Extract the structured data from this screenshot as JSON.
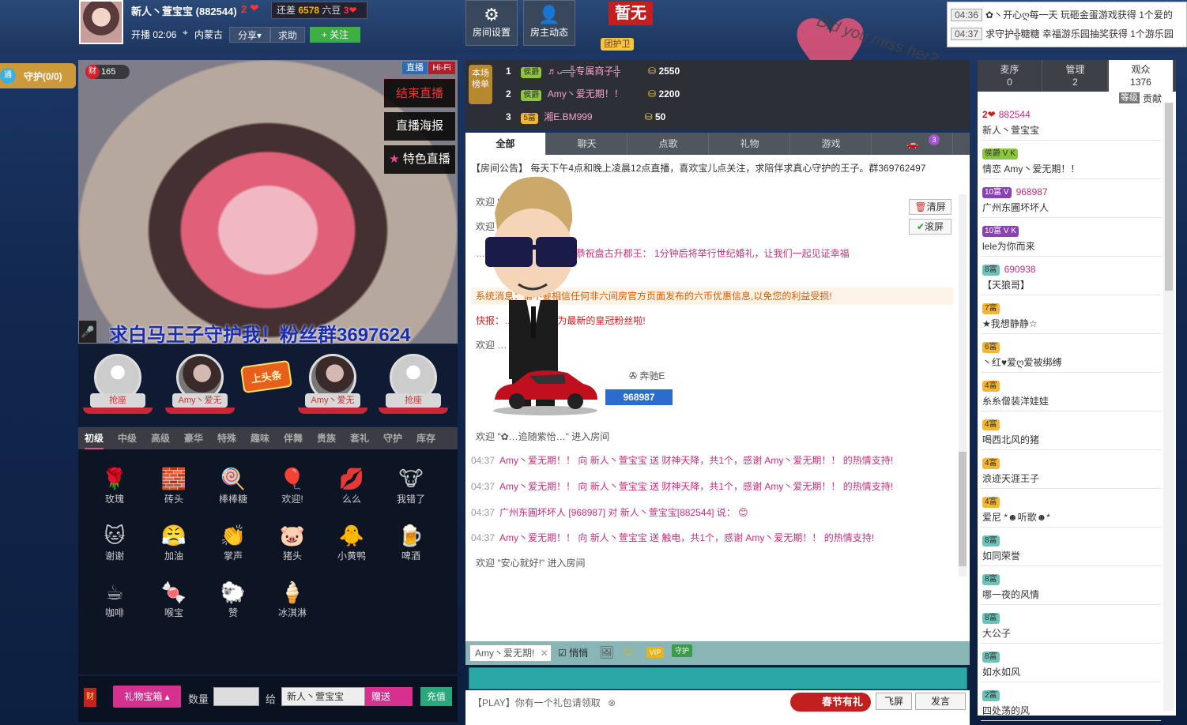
{
  "header": {
    "host_name": "新人丶萱宝宝",
    "host_id": "(882544)",
    "host_rank": "2",
    "gap_text_prefix": "还差",
    "gap_amount": "6578",
    "gap_text_suffix": "六豆",
    "gap_rank": "3",
    "live_time": "开播 02:06",
    "location": "内蒙古",
    "share_label": "分享▾",
    "help_label": "求助",
    "follow_label": "+ 关注",
    "room_settings_label": "房间设置",
    "host_dynamic_label": "房主动态",
    "no_label": "暂无",
    "guard_team_label": "团护卫",
    "heart_text": "Did you miss her?"
  },
  "ticker": [
    {
      "time": "04:36",
      "text": "✿丶开心ღ每一天 玩砸金蛋游戏获得 1个爱的"
    },
    {
      "time": "04:37",
      "text": "求守护╬糖糖 幸福游乐园抽奖获得 1个游乐园"
    }
  ],
  "guard": {
    "badge": "通",
    "label": "守护(0/0)"
  },
  "video": {
    "live_badge": "直播",
    "hifi_badge": "Hi-Fi",
    "viewer_icon": "财",
    "viewer_count": "165",
    "end_live": "结束直播",
    "live_poster": "直播海报",
    "special_live": "特色直播",
    "caption": "求白马王子守护我！粉丝群3697624"
  },
  "seats": [
    {
      "label": "抢座",
      "type": "empty"
    },
    {
      "label": "Amy丶爱无",
      "type": "user"
    },
    {
      "label": "Amy丶爱无",
      "type": "user"
    },
    {
      "label": "抢座",
      "type": "empty"
    }
  ],
  "headline": "上头条",
  "gift_tabs": [
    "初级",
    "中级",
    "高级",
    "豪华",
    "特殊",
    "趣味",
    "伴舞",
    "贵族",
    "套礼",
    "守护",
    "库存"
  ],
  "gifts": [
    {
      "icon": "🌹",
      "name": "玫瑰"
    },
    {
      "icon": "🧱",
      "name": "砖头"
    },
    {
      "icon": "🍭",
      "name": "棒棒糖"
    },
    {
      "icon": "🎈",
      "name": "欢迎!"
    },
    {
      "icon": "💋",
      "name": "么么"
    },
    {
      "icon": "🐮",
      "name": "我错了"
    },
    {
      "icon": "🐱",
      "name": "谢谢"
    },
    {
      "icon": "😤",
      "name": "加油"
    },
    {
      "icon": "👏",
      "name": "掌声"
    },
    {
      "icon": "🐷",
      "name": "猪头"
    },
    {
      "icon": "🐥",
      "name": "小黄鸭"
    },
    {
      "icon": "🍺",
      "name": "啤酒"
    },
    {
      "icon": "☕",
      "name": "咖啡"
    },
    {
      "icon": "🍬",
      "name": "喉宝"
    },
    {
      "icon": "🐑",
      "name": "赞"
    },
    {
      "icon": "🍦",
      "name": "冰淇淋"
    }
  ],
  "gift_bar": {
    "fortune": "财",
    "gift_box": "礼物宝箱 ▴",
    "qty_label": "数量",
    "to_label": "给",
    "to_value": "新人丶萱宝宝",
    "send": "赠送",
    "recharge": "充值"
  },
  "leaderboard": {
    "tag": "本场榜单",
    "rows": [
      {
        "rank": "1",
        "level": "侯爵",
        "name": "♬ᴗ═╬专属商子╬",
        "score": "2550"
      },
      {
        "rank": "2",
        "level": "侯爵",
        "name": "Amy丶爱无期！！",
        "score": "2200"
      },
      {
        "rank": "3",
        "level": "5富",
        "name": "湘E.BM999",
        "score": "50"
      }
    ]
  },
  "chat_tabs": [
    "全部",
    "聊天",
    "点歌",
    "礼物",
    "游戏",
    "🚗"
  ],
  "car_badge": "3",
  "chat": {
    "notice_tag": "【房间公告】",
    "notice": "每天下午4点和晚上凌晨12点直播，喜欢宝儿点关注，求陪伴求真心守护的王子。群369762497",
    "clear": "清屏",
    "scroll": "滚屏",
    "lines": [
      {
        "time": "",
        "text": "欢迎 \"…择\" 进入房间"
      },
      {
        "time": "",
        "text": "欢迎 … 间"
      },
      {
        "time": "",
        "text": "…古．大．帝． 和 龙儿恭祝盘古升郡王： 1分钟后将举行世纪婚礼，让我们一起见证幸福"
      },
      {
        "time": "",
        "text": "系统消息：请不要相信任何非六间房官方页面发布的六币优惠信息,以免您的利益受损!"
      },
      {
        "time": "",
        "text": "快报：… 商子╬ \"成为最新的皇冠粉丝啦!"
      },
      {
        "time": "",
        "text": "欢迎 … 进入房间"
      },
      {
        "time": "",
        "text": "欢迎 \"✿…追随紫怡…\" 进入房间"
      },
      {
        "time": "04:37",
        "text": "Amy丶爱无期！！ 向 新人丶萱宝宝 送 财神天降，共1个，感谢 Amy丶爱无期！！ 的热情支持!"
      },
      {
        "time": "04:37",
        "text": "Amy丶爱无期！！ 向 新人丶萱宝宝 送 财神天降，共1个，感谢 Amy丶爱无期！！ 的热情支持!"
      },
      {
        "time": "04:37",
        "text": "广州东圃坏坏人 [968987] 对 新人丶萱宝宝[882544] 说： 😊"
      },
      {
        "time": "04:37",
        "text": "Amy丶爱无期！！ 向 新人丶萱宝宝 送 触电，共1个，感谢 Amy丶爱无期！！ 的热情支持!"
      },
      {
        "time": "",
        "text": "欢迎 \"安心就好!\" 进入房间"
      }
    ],
    "car_name": "奔驰E",
    "car_id": "968987"
  },
  "input": {
    "target": "Amy丶爱无期!",
    "whisper": "悄悄",
    "play_msg": "【PLAY】你有一个礼包请领取",
    "spring_gift": "春节有礼",
    "fly": "飞屏",
    "speak": "发言"
  },
  "right": {
    "tabs": [
      {
        "label": "麦序",
        "count": "0"
      },
      {
        "label": "管理",
        "count": "2"
      },
      {
        "label": "观众",
        "count": "1376"
      }
    ],
    "rank_tag": "等级",
    "contrib": "贡献",
    "users": [
      {
        "tags": "2❤",
        "uid": "882544",
        "name": "新人丶萱宝宝"
      },
      {
        "tags": "侯爵 V K",
        "uid": "",
        "name": "情恋 Amy丶爱无期！！"
      },
      {
        "tags": "10富 V",
        "uid": "968987",
        "name": "广州东圃坏坏人"
      },
      {
        "tags": "10富 V K",
        "uid": "",
        "name": "lele为你而来"
      },
      {
        "tags": "8富",
        "uid": "690938",
        "name": "【天狼哥】"
      },
      {
        "tags": "7富",
        "uid": "",
        "name": "★我想静静☆"
      },
      {
        "tags": "6富",
        "uid": "",
        "name": "丶红♥爱ღ爱被绑缚"
      },
      {
        "tags": "4富",
        "uid": "",
        "name": "糸糸僧装洋娃娃"
      },
      {
        "tags": "4富",
        "uid": "",
        "name": "喝西北风的猪"
      },
      {
        "tags": "4富",
        "uid": "",
        "name": "浪迹天涯王子"
      },
      {
        "tags": "4富",
        "uid": "",
        "name": "爱尼 *☻听歌☻*"
      },
      {
        "tags": "8富",
        "uid": "",
        "name": "如同荣誉"
      },
      {
        "tags": "8富",
        "uid": "",
        "name": "哪一夜的风情"
      },
      {
        "tags": "8富",
        "uid": "",
        "name": "大公子"
      },
      {
        "tags": "8富",
        "uid": "",
        "name": "如水如风"
      },
      {
        "tags": "2富",
        "uid": "",
        "name": "四处荡的风"
      }
    ]
  }
}
